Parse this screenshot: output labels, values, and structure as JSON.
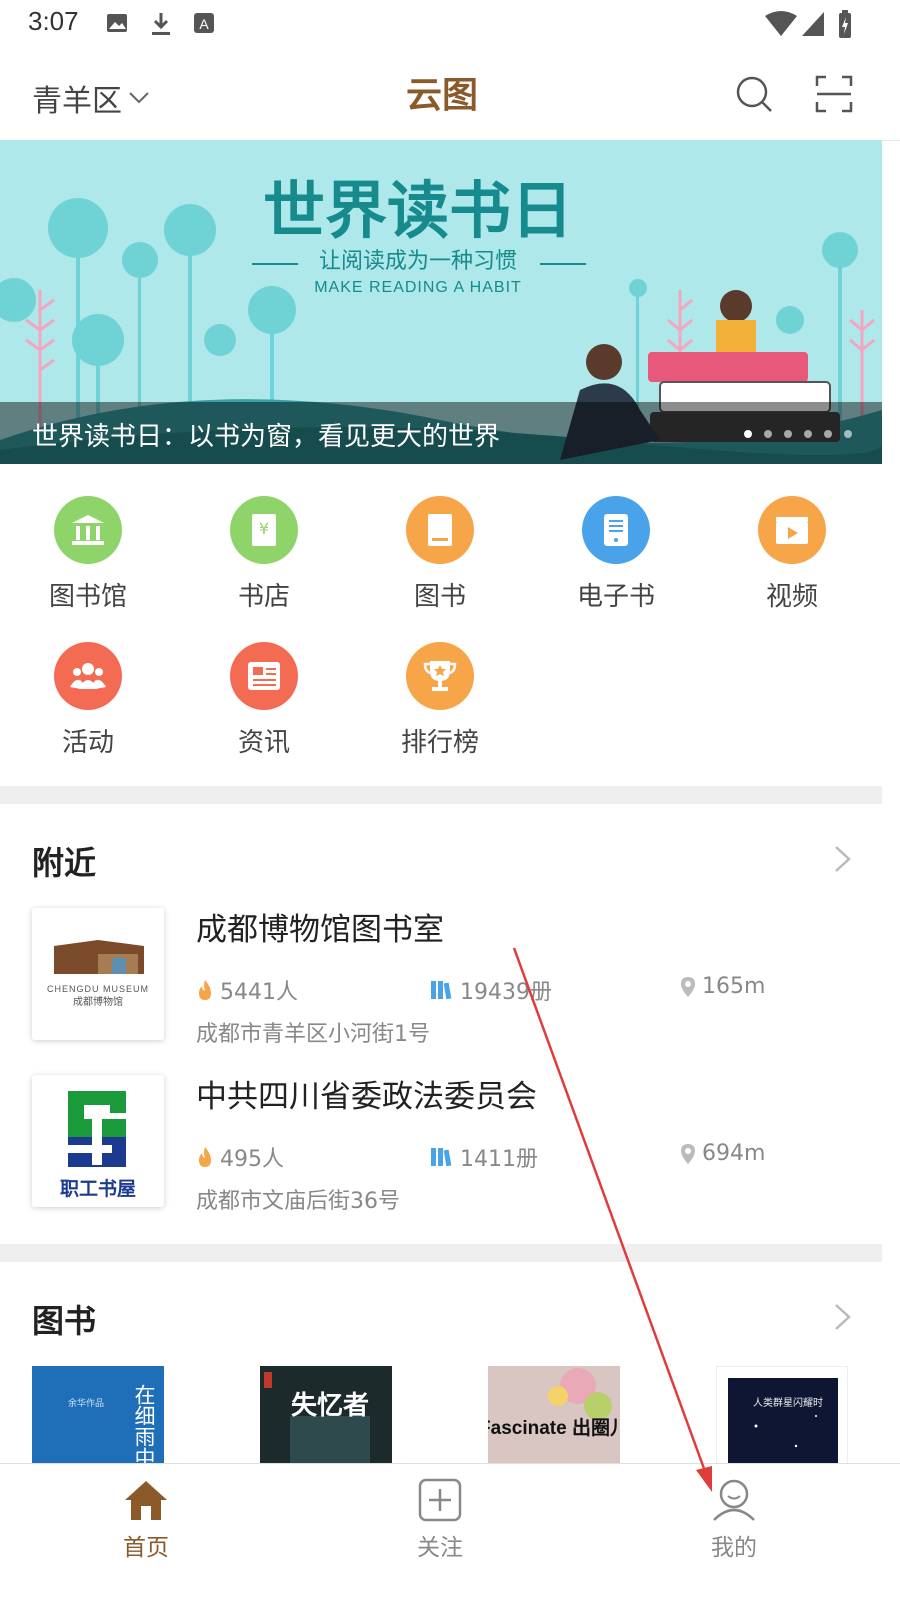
{
  "status_bar": {
    "time": "3:07"
  },
  "header": {
    "district": "青羊区",
    "logo_text": "云图"
  },
  "banner": {
    "title": "世界读书日",
    "subtitle": "让阅读成为一种习惯",
    "subtitle_en": "MAKE READING A HABIT",
    "caption": "世界读书日：以书为窗，看见更大的世界",
    "slide_count": 6,
    "active_slide": 1
  },
  "categories": [
    {
      "label": "图书馆",
      "icon": "library-icon",
      "color": "#8fd46b"
    },
    {
      "label": "书店",
      "icon": "bookstore-icon",
      "color": "#8fd46b"
    },
    {
      "label": "图书",
      "icon": "book-icon",
      "color": "#f6a548"
    },
    {
      "label": "电子书",
      "icon": "ebook-icon",
      "color": "#4aa3e8"
    },
    {
      "label": "视频",
      "icon": "video-icon",
      "color": "#f6a548"
    },
    {
      "label": "活动",
      "icon": "activity-icon",
      "color": "#f26b52"
    },
    {
      "label": "资讯",
      "icon": "news-icon",
      "color": "#f26b52"
    },
    {
      "label": "排行榜",
      "icon": "trophy-icon",
      "color": "#f6a548"
    }
  ],
  "nearby": {
    "title": "附近",
    "items": [
      {
        "name": "成都博物馆图书室",
        "visitors": "5441人",
        "books": "19439册",
        "distance": "165m",
        "address": "成都市青羊区小河街1号",
        "logo_text_en": "CHENGDU MUSEUM",
        "logo_text_cn": "成都博物馆"
      },
      {
        "name": "中共四川省委政法委员会",
        "visitors": "495人",
        "books": "1411册",
        "distance": "694m",
        "address": "成都市文庙后街36号",
        "logo_text_cn": "职工书屋"
      }
    ]
  },
  "books_section": {
    "title": "图书",
    "covers": [
      {
        "title": "在细雨中呼喊",
        "author": "余华作品",
        "color": "#1e6fb8"
      },
      {
        "title": "失忆者",
        "color": "#1d2a2c"
      },
      {
        "title": "Fascinate 出圈儿",
        "color": "#d9c6c2"
      },
      {
        "title": "人类群星闪耀时",
        "color": "#ffffff"
      }
    ]
  },
  "bottom_nav": [
    {
      "label": "首页",
      "icon": "home-icon",
      "active": true
    },
    {
      "label": "关注",
      "icon": "plus-square-icon",
      "active": false
    },
    {
      "label": "我的",
      "icon": "profile-icon",
      "active": false
    }
  ],
  "colors": {
    "brand": "#8a5a2b",
    "annotation_arrow": "#e03c3c"
  }
}
